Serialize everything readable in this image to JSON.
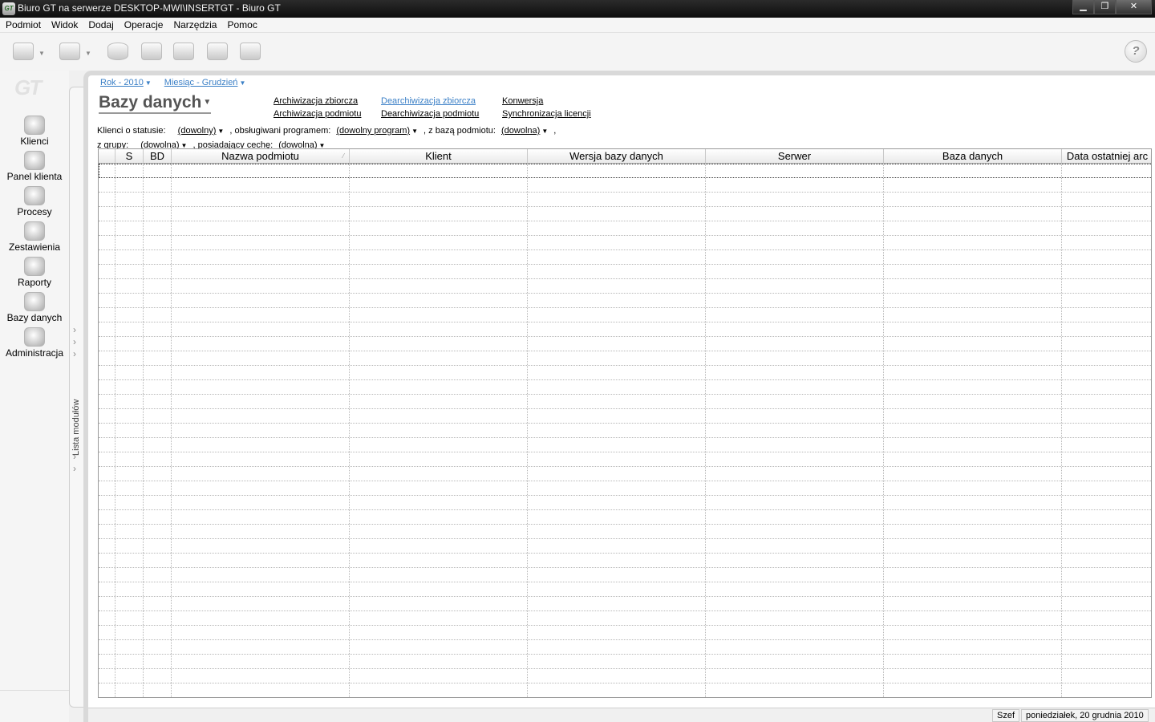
{
  "window": {
    "title": "Biuro GT na serwerze DESKTOP-MWI\\INSERTGT - Biuro GT",
    "app_icon": "GT",
    "controls": {
      "minimize": "▁",
      "maximize": "❐",
      "close": "✕"
    }
  },
  "menu": [
    "Podmiot",
    "Widok",
    "Dodaj",
    "Operacje",
    "Narzędzia",
    "Pomoc"
  ],
  "toolbar": {
    "buttons": [
      "send-icon",
      "receive-icon",
      "database-icon",
      "archive-icon",
      "restore-icon",
      "convert-icon",
      "license-icon"
    ],
    "help": "?"
  },
  "sidebar": {
    "logo": "GT",
    "items": [
      {
        "label": "Klienci",
        "icon": "client-icon"
      },
      {
        "label": "Panel klienta",
        "icon": "client-panel-icon"
      },
      {
        "label": "Procesy",
        "icon": "gears-icon"
      },
      {
        "label": "Zestawienia",
        "icon": "summary-icon"
      },
      {
        "label": "Raporty",
        "icon": "reports-icon"
      },
      {
        "label": "Bazy danych",
        "icon": "database-icon"
      },
      {
        "label": "Administracja",
        "icon": "admin-icon"
      }
    ]
  },
  "module_list": {
    "label": "Lista modułów"
  },
  "breadcrumb": {
    "year": "Rok - 2010",
    "month": "Miesiąc - Grudzień"
  },
  "page": {
    "title": "Bazy danych"
  },
  "actions": {
    "col1": [
      "Archiwizacja zbiorcza",
      "Archiwizacja podmiotu"
    ],
    "col2": [
      "Dearchiwizacja zbiorcza",
      "Dearchiwizacja podmiotu"
    ],
    "col3": [
      "Konwersja",
      "Synchronizacja licencji"
    ]
  },
  "filters": {
    "status_label": "Klienci o statusie:",
    "status_value": "(dowolny)",
    "program_label": ", obsługiwani programem:",
    "program_value": "(dowolny program)",
    "db_label": ", z bazą podmiotu:",
    "db_value": "(dowolna)",
    "group_label": "z grupy:",
    "group_value": "(dowolna)",
    "feature_label": ", posiadający cechę:",
    "feature_value": "(dowolna)",
    "comma": ","
  },
  "table": {
    "columns": [
      "",
      "S",
      "BD",
      "Nazwa podmiotu",
      "Klient",
      "Wersja bazy danych",
      "Serwer",
      "Baza danych",
      "Data ostatniej arc"
    ],
    "sort_mark": "⁄",
    "rows": []
  },
  "status": {
    "user": "Szef",
    "date": "poniedziałek, 20 grudnia 2010"
  }
}
